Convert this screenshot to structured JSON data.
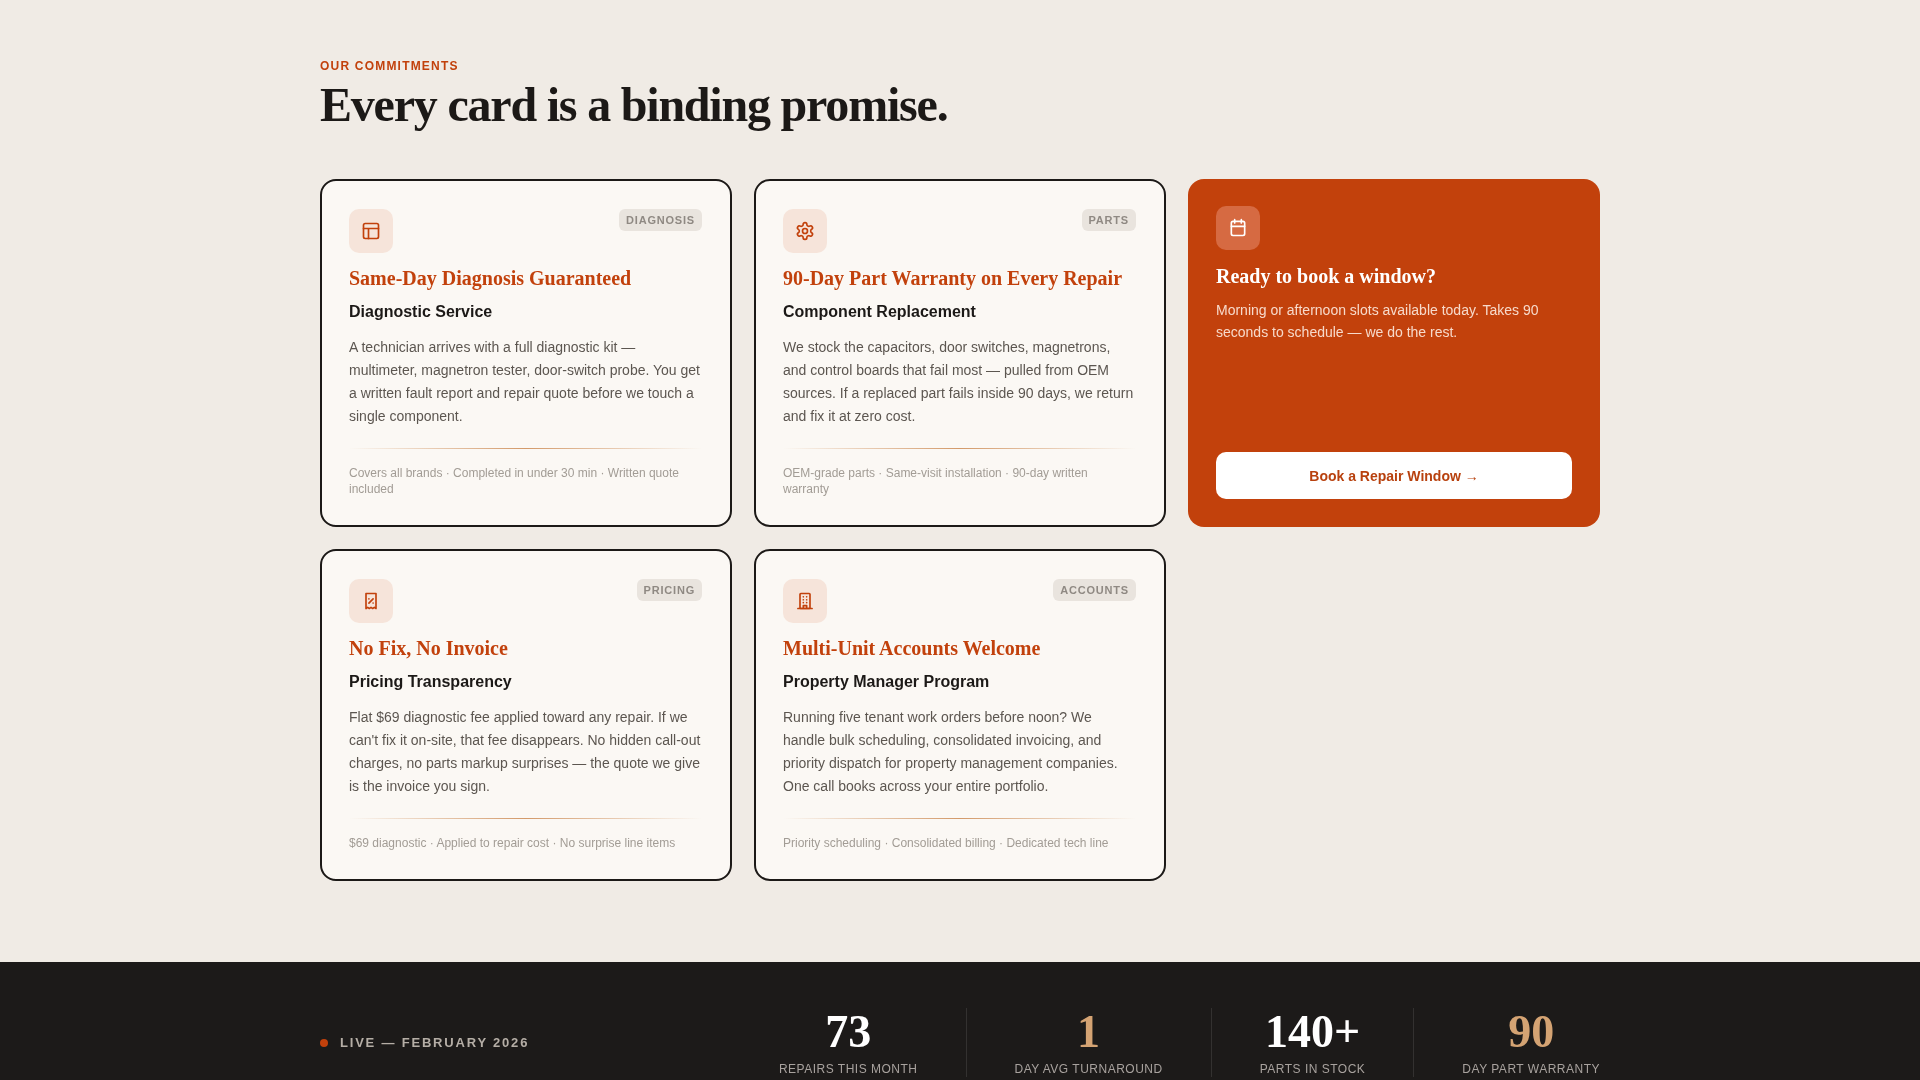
{
  "section": {
    "eyebrow": "OUR COMMITMENTS",
    "heading": "Every card is a binding promise."
  },
  "cards": [
    {
      "kind": "service",
      "tag": "DIAGNOSIS",
      "title": "Same-Day Diagnosis Guaranteed",
      "subtitle": "Diagnostic Service",
      "body": "A technician arrives with a full diagnostic kit — multimeter, magnetron tester, door-switch probe. You get a written fault report and repair quote before we touch a single component.",
      "features": "Covers all brands · Completed in under 30 min · Written quote included"
    },
    {
      "kind": "service",
      "tag": "PARTS",
      "title": "90-Day Part Warranty on Every Repair",
      "subtitle": "Component Replacement",
      "body": "We stock the capacitors, door switches, magnetrons, and control boards that fail most — pulled from OEM sources. If a replaced part fails inside 90 days, we return and fix it at zero cost.",
      "features": "OEM-grade parts · Same-visit installation · 90-day written warranty"
    },
    {
      "kind": "cta",
      "title": "Ready to book a window?",
      "body": "Morning or afternoon slots available today. Takes 90 seconds to schedule — we do the rest.",
      "button": "Book a Repair Window →"
    },
    {
      "kind": "service",
      "tag": "PRICING",
      "title": "No Fix, No Invoice",
      "subtitle": "Pricing Transparency",
      "body": "Flat $69 diagnostic fee applied toward any repair. If we can't fix it on-site, that fee disappears. No hidden call-out charges, no parts markup surprises — the quote we give is the invoice you sign.",
      "features": "$69 diagnostic · Applied to repair cost · No surprise line items"
    },
    {
      "kind": "service",
      "tag": "ACCOUNTS",
      "title": "Multi-Unit Accounts Welcome",
      "subtitle": "Property Manager Program",
      "body": "Running five tenant work orders before noon? We handle bulk scheduling, consolidated invoicing, and priority dispatch for property management companies. One call books across your entire portfolio.",
      "features": "Priority scheduling · Consolidated billing · Dedicated tech line"
    }
  ],
  "stats_bar": {
    "live_label": "LIVE — FEBRUARY 2026",
    "stats": [
      {
        "value": "73",
        "label": "REPAIRS THIS MONTH",
        "color": "#ffffff"
      },
      {
        "value": "1",
        "label": "DAY AVG TURNAROUND",
        "color": "#d4a373"
      },
      {
        "value": "140+",
        "label": "PARTS IN STOCK",
        "color": "#ffffff"
      },
      {
        "value": "90",
        "label": "DAY PART WARRANTY",
        "color": "#d4a373"
      }
    ]
  }
}
